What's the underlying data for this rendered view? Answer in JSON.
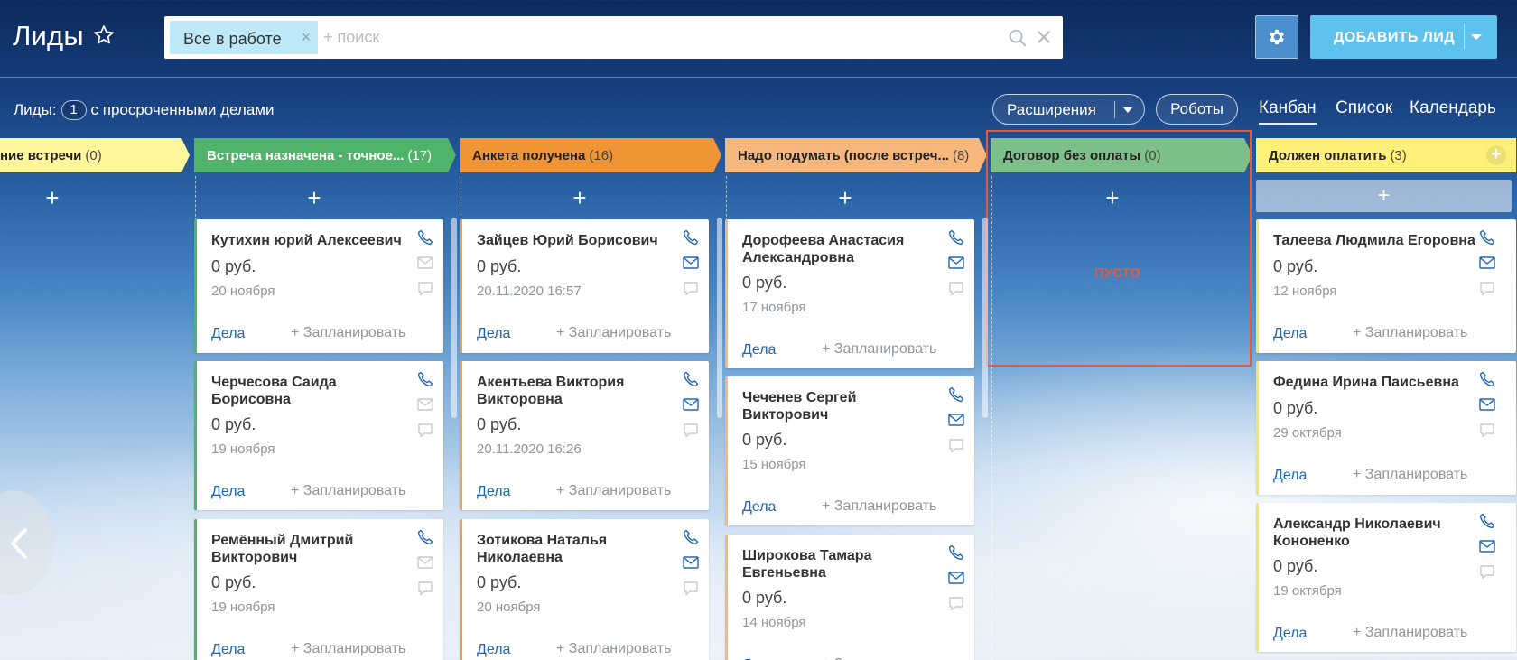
{
  "header": {
    "title": "Лиды",
    "filter_chip": "Все в работе",
    "search_placeholder": "+ поиск",
    "add_button": "ДОБАВИТЬ ЛИД"
  },
  "toolbar": {
    "overdue_prefix": "Лиды:",
    "overdue_count": "1",
    "overdue_suffix": "с просроченными делами",
    "extensions": "Расширения",
    "robots": "Роботы",
    "views": [
      "Канбан",
      "Список",
      "Календарь"
    ],
    "active_view": "Канбан"
  },
  "card_labels": {
    "tasks": "Дела",
    "plan": "+ Запланировать"
  },
  "empty_label": "ПУСТО",
  "colors": {
    "col0": "#fff59b",
    "col1": "#4fb36a",
    "col2": "#f09536",
    "col3": "#f6b67c",
    "col4": "#7ec08a",
    "col5": "#fff07a",
    "empty_border": "#e25a3f",
    "link": "#2067b0"
  },
  "icons": {
    "phone": "phone-icon",
    "mail": "mail-icon",
    "comment": "comment-icon",
    "star": "star-icon",
    "gear": "gear-icon"
  },
  "columns": [
    {
      "title": "ние встречи",
      "count": "(0)",
      "cards": []
    },
    {
      "title": "Встреча назначена - точное...",
      "count": "(17)",
      "cards": [
        {
          "name": "Кутихин юрий Алексеевич",
          "price": "0 руб.",
          "date": "20 ноября",
          "mail_active": false
        },
        {
          "name": "Черчесова Саида Борисовна",
          "price": "0 руб.",
          "date": "19 ноября",
          "mail_active": false
        },
        {
          "name": "Ремённый Дмитрий Викторович",
          "price": "0 руб.",
          "date": "19 ноября",
          "mail_active": false
        }
      ]
    },
    {
      "title": "Анкета получена",
      "count": "(16)",
      "cards": [
        {
          "name": "Зайцев Юрий Борисович",
          "price": "0 руб.",
          "date": "20.11.2020 16:57",
          "mail_active": true
        },
        {
          "name": "Акентьева Виктория Викторовна",
          "price": "0 руб.",
          "date": "20.11.2020 16:26",
          "mail_active": true
        },
        {
          "name": "Зотикова Наталья Николаевна",
          "price": "0 руб.",
          "date": "20 ноября",
          "mail_active": true
        }
      ]
    },
    {
      "title": "Надо подумать (после встреч...",
      "count": "(8)",
      "cards": [
        {
          "name": "Дорофеева Анастасия Александровна",
          "price": "0 руб.",
          "date": "17 ноября",
          "mail_active": true
        },
        {
          "name": "Чеченев Сергей Викторович",
          "price": "0 руб.",
          "date": "15 ноября",
          "mail_active": true
        },
        {
          "name": "Широкова Тамара Евгеньевна",
          "price": "0 руб.",
          "date": "14 ноября",
          "mail_active": true
        }
      ]
    },
    {
      "title": "Договор без оплаты",
      "count": "(0)",
      "cards": []
    },
    {
      "title": "Должен оплатить",
      "count": "(3)",
      "cards": [
        {
          "name": "Талеева Людмила Егоровна",
          "price": "0 руб.",
          "date": "12 ноября",
          "mail_active": true
        },
        {
          "name": "Федина Ирина Паисьевна",
          "price": "0 руб.",
          "date": "29 октября",
          "mail_active": true
        },
        {
          "name": "Александр Николаевич Кононенко",
          "price": "0 руб.",
          "date": "19 октября",
          "mail_active": true
        }
      ]
    }
  ]
}
